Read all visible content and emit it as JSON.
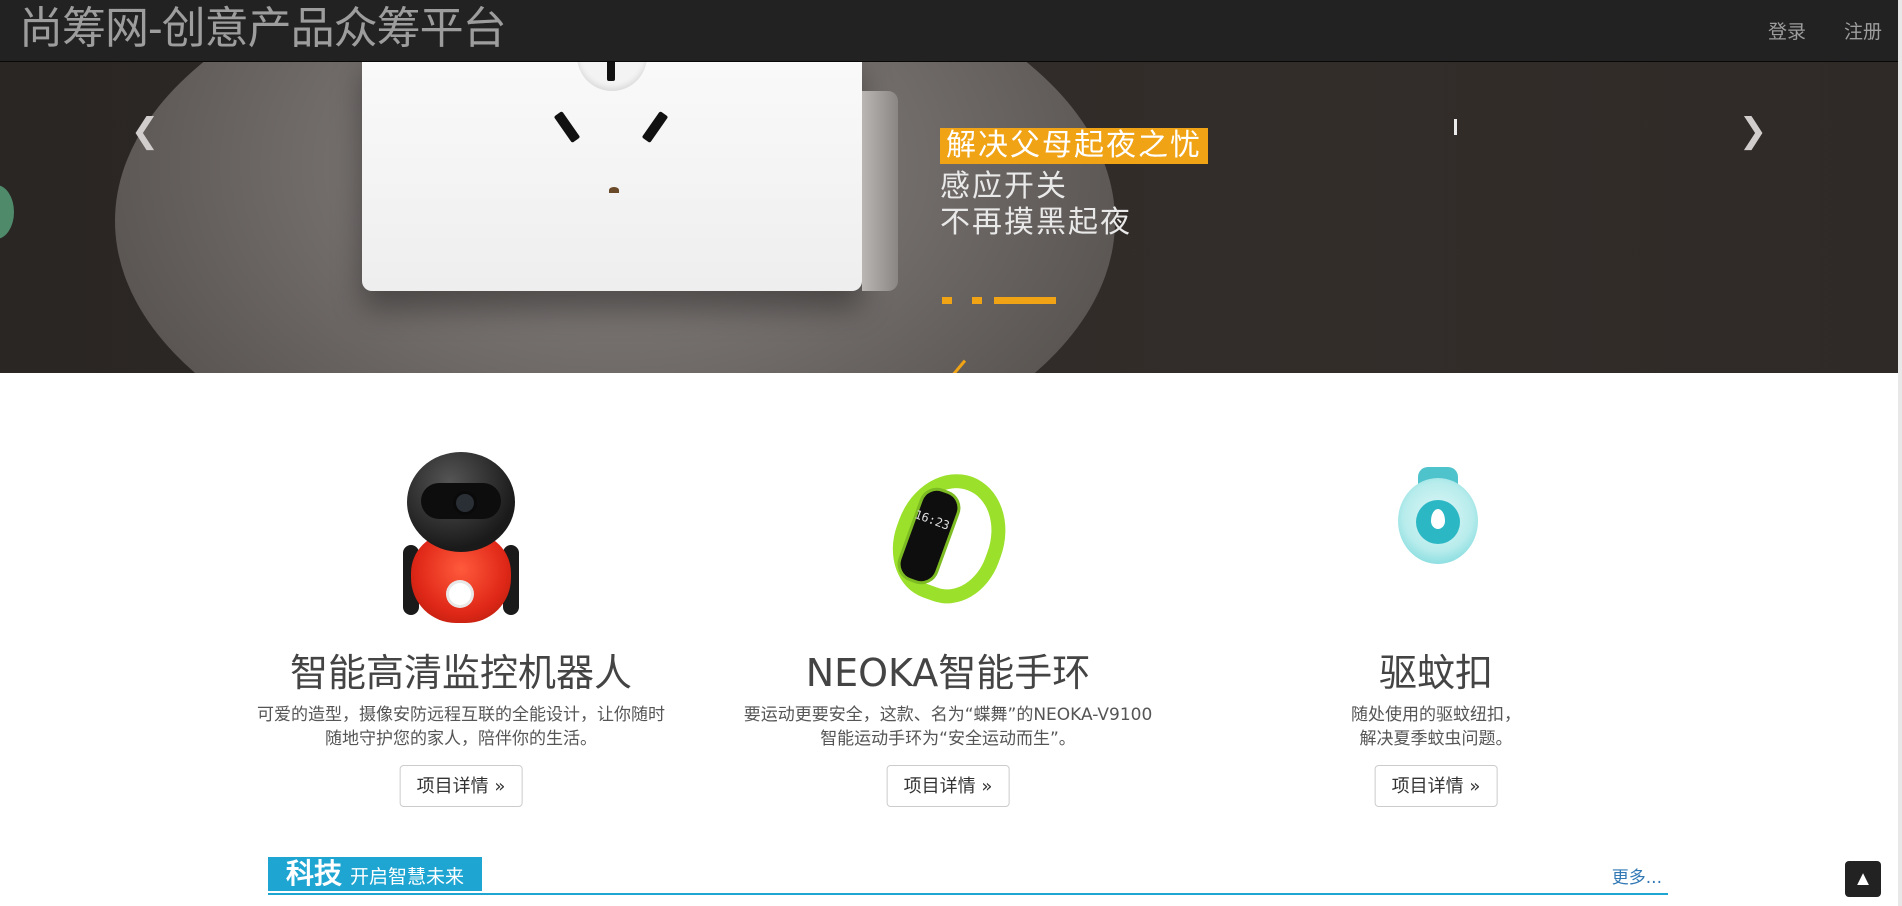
{
  "navbar": {
    "brand": "尚筹网-创意产品众筹平台",
    "links": [
      "登录",
      "注册"
    ]
  },
  "carousel": {
    "headline": "解决父母起夜之忧",
    "line1": "感应开关",
    "line2": "不再摸黑起夜",
    "prev_icon": "chevron-left-icon",
    "next_icon": "chevron-right-icon",
    "indicator_count": 3,
    "active_indicator": 2,
    "accent": "#f0a314"
  },
  "features": [
    {
      "title": "智能高清监控机器人",
      "desc_line1": "可爱的造型，摄像安防远程互联的全能设计，让你随时",
      "desc_line2": "随地守护您的家人，陪伴你的生活。",
      "button": "项目详情 »"
    },
    {
      "title": "NEOKA智能手环",
      "desc_line1": "要运动更要安全，这款、名为“蝶舞”的NEOKA-V9100",
      "desc_line2": "智能运动手环为“安全运动而生”。",
      "button": "项目详情 »",
      "band_time": "16:23"
    },
    {
      "title": "驱蚊扣",
      "desc_line1": "随处使用的驱蚊纽扣，",
      "desc_line2": "解决夏季蚊虫问题。",
      "button": "项目详情 »"
    }
  ],
  "section": {
    "tag_big": "科技",
    "tag_small": "开启智慧未来",
    "more": "更多...",
    "accent": "#1ea5d2"
  },
  "back_to_top": "▲"
}
